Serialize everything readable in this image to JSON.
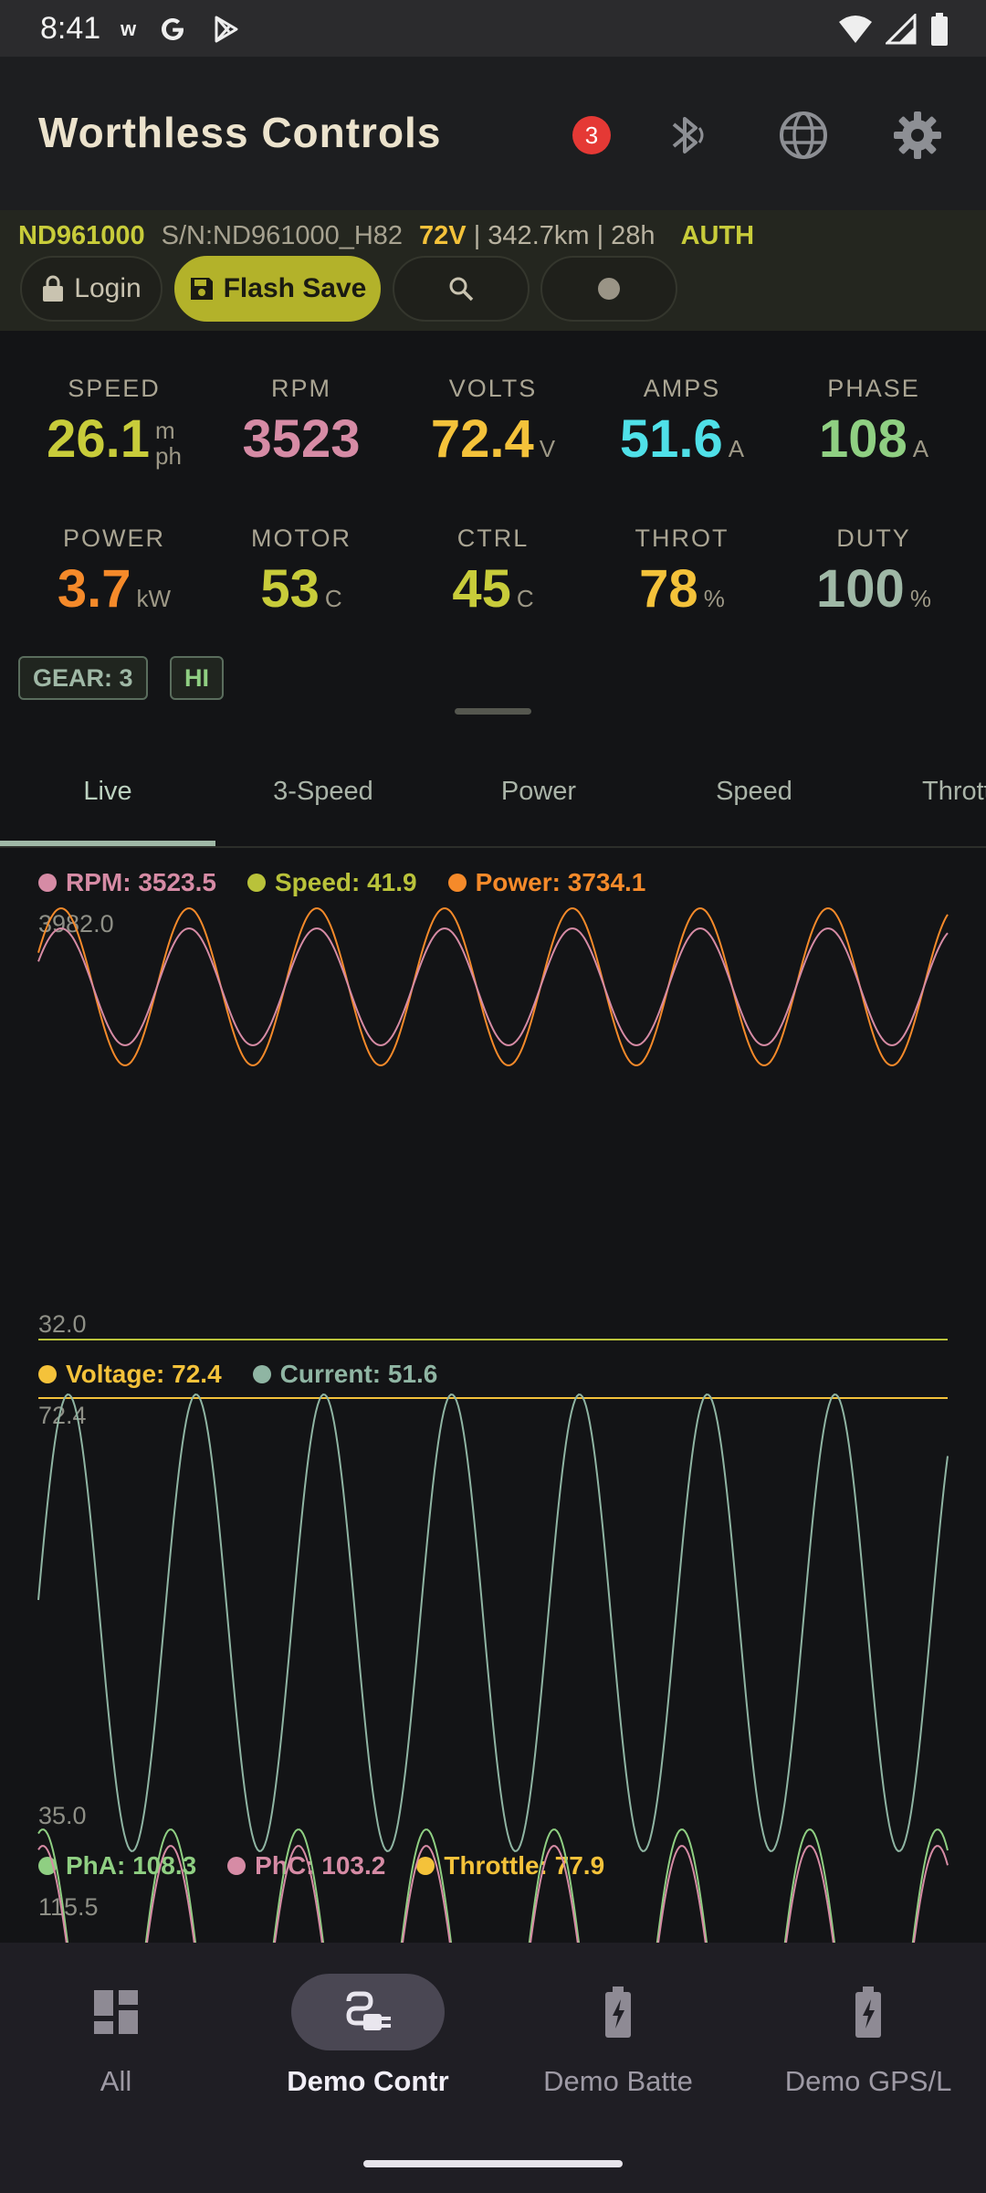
{
  "status_bar": {
    "time": "8:41",
    "notif_w": "w"
  },
  "app_bar": {
    "title": "Worthless Controls",
    "badge_count": "3"
  },
  "device": {
    "id": "ND961000",
    "serial": "S/N:ND961000_H82",
    "voltage": "72V",
    "trip": " | 342.7km | 28h",
    "auth": "AUTH",
    "buttons": {
      "login": "Login",
      "flash_save": "Flash Save"
    }
  },
  "metrics": {
    "speed": {
      "label": "SPEED",
      "value": "26.1",
      "unit_top": "m",
      "unit_bottom": "ph",
      "color": "#c8cc3a"
    },
    "rpm": {
      "label": "RPM",
      "value": "3523",
      "color": "#d68ba5"
    },
    "volts": {
      "label": "VOLTS",
      "value": "72.4",
      "unit": "V",
      "color": "#f4c23a"
    },
    "amps": {
      "label": "AMPS",
      "value": "51.6",
      "unit": "A",
      "color": "#4fe0e8"
    },
    "phase": {
      "label": "PHASE",
      "value": "108",
      "unit": "A",
      "color": "#8fcf82"
    },
    "power": {
      "label": "POWER",
      "value": "3.7",
      "unit": "kW",
      "color": "#f58a2a"
    },
    "motor": {
      "label": "MOTOR",
      "value": "53",
      "unit": "C",
      "color": "#c8cc3a"
    },
    "ctrl": {
      "label": "CTRL",
      "value": "45",
      "unit": "C",
      "color": "#c8cc3a"
    },
    "throt": {
      "label": "THROT",
      "value": "78",
      "unit": "%",
      "color": "#f4c23a"
    },
    "duty": {
      "label": "DUTY",
      "value": "100",
      "unit": "%",
      "color": "#9fb8a6"
    }
  },
  "chips": {
    "gear": "GEAR: 3",
    "hi": "HI"
  },
  "tabs": [
    "Live",
    "3-Speed",
    "Power",
    "Speed",
    "Throttle"
  ],
  "charts": {
    "top": {
      "legend": [
        {
          "label": "RPM: 3523.5",
          "color": "#d68ba5"
        },
        {
          "label": "Speed: 41.9",
          "color": "#b9c23a"
        },
        {
          "label": "Power: 3734.1",
          "color": "#f58a2a"
        }
      ],
      "ymax_label": "3982.0",
      "ymin_label": "32.0"
    },
    "middle": {
      "legend": [
        {
          "label": "Voltage: 72.4",
          "color": "#f4c23a"
        },
        {
          "label": "Current: 51.6",
          "color": "#8fb5a3"
        }
      ],
      "ymax_label": "72.4",
      "ymin_label": "35.0"
    },
    "bottom": {
      "legend": [
        {
          "label": "PhA: 108.3",
          "color": "#8fcf82"
        },
        {
          "label": "PhC: 103.2",
          "color": "#d68ba5"
        },
        {
          "label": "Throttle: 77.9",
          "color": "#f4c23a"
        }
      ],
      "ymax_label": "115.5"
    }
  },
  "bottom_nav": [
    {
      "label": "All",
      "icon": "dashboard-icon"
    },
    {
      "label": "Demo Contr",
      "icon": "plug-icon",
      "active": true
    },
    {
      "label": "Demo Batte",
      "icon": "battery-icon"
    },
    {
      "label": "Demo GPS/L",
      "icon": "battery-icon"
    }
  ]
}
